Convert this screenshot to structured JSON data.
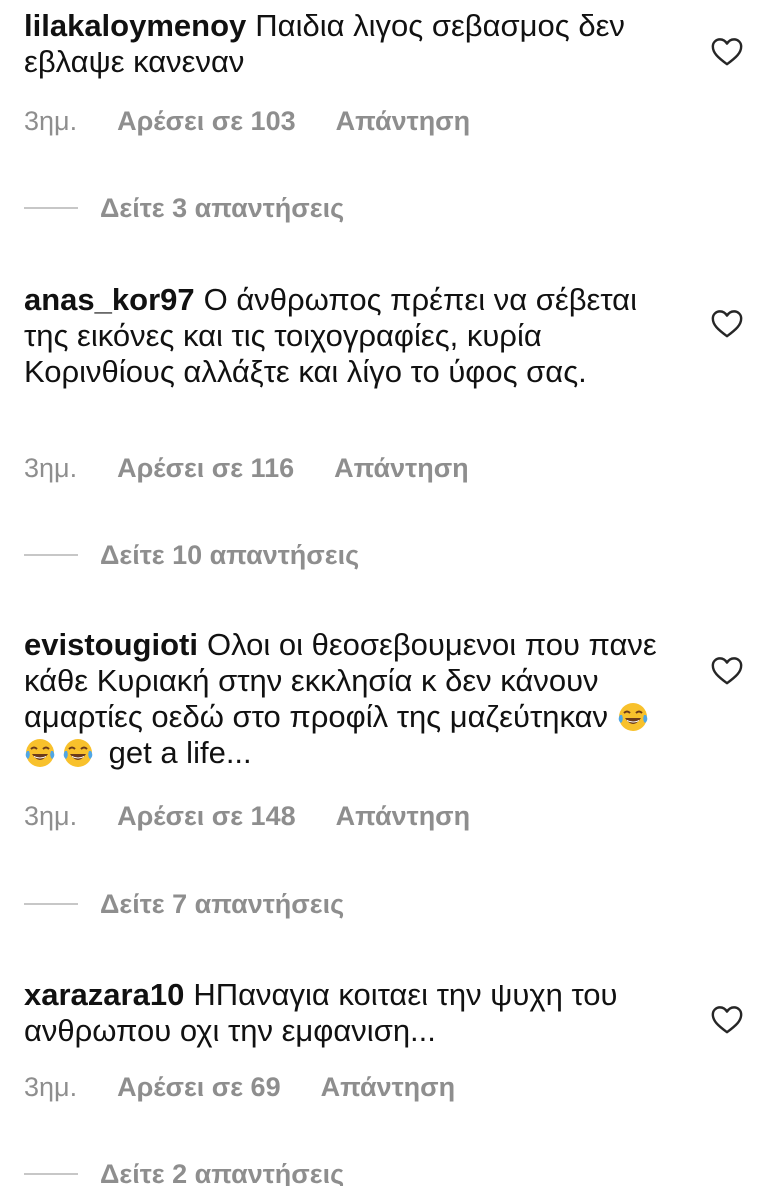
{
  "comments": [
    {
      "username": "lilakaloymenoy",
      "text": "Παιδια λιγος σεβασμος δεν εβλαψε κανεναν",
      "time": "3ημ.",
      "likes": "Αρέσει σε 103",
      "reply": "Απάντηση",
      "view_replies": "Δείτε 3 απαντήσεις"
    },
    {
      "username": "anas_kor97",
      "text": "Ο άνθρωπος  πρέπει να σέβεται  της εικόνες  και  τις τοιχογραφίες, κυρία  Κορινθίους αλλάξτε και λίγο  το ύφος  σας.",
      "time": "3ημ.",
      "likes": "Αρέσει σε 116",
      "reply": "Απάντηση",
      "view_replies": "Δείτε 10 απαντήσεις"
    },
    {
      "username": "evistougioti",
      "text_line1": "Ολοι οι θεοσεβουμενοι που πανε κάθε Κυριακή στην εκκλησία κ δεν κάνουν αμαρτίες οεδώ στο προφίλ της μαζεύτηκαν",
      "text_after_emoji": "get a life...",
      "emoji_icon": "face-with-tears-of-joy",
      "time": "3ημ.",
      "likes": "Αρέσει σε 148",
      "reply": "Απάντηση",
      "view_replies": "Δείτε 7 απαντήσεις"
    },
    {
      "username": "xarazara10",
      "text": "ΗΠαναγια κοιταει την ψυχη του ανθρωπου οχι την εμφανιση...",
      "time": "3ημ.",
      "likes": "Αρέσει σε 69",
      "reply": "Απάντηση",
      "view_replies": "Δείτε 2 απαντήσεις"
    }
  ],
  "colors": {
    "text": "#111111",
    "meta": "#8e8e8e",
    "line": "#c7c7c7",
    "background": "#ffffff"
  },
  "icons": {
    "like": "heart-outline-icon"
  }
}
